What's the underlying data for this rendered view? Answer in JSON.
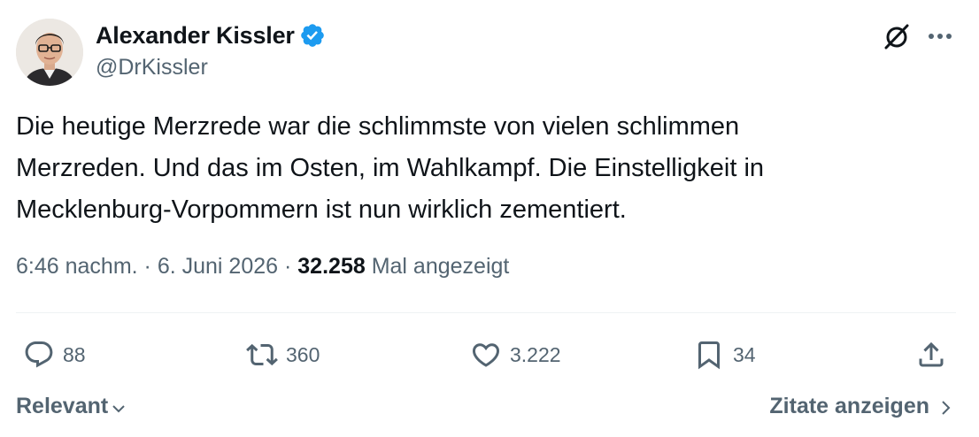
{
  "author": {
    "display_name": "Alexander Kissler",
    "handle": "@DrKissler",
    "verified": true
  },
  "tweet": {
    "text_lines": [
      "Die heutige Merzrede war die schlimmste von vielen schlimmen",
      "Merzreden. Und das im Osten, im Wahlkampf. Die Einstelligkeit in",
      "Mecklenburg-Vorpommern ist nun wirklich zementiert."
    ],
    "time": "6:46 nachm.",
    "date": "6. Juni 2026",
    "separator": "·",
    "views": "32.258",
    "views_label": "Mal angezeigt"
  },
  "actions": {
    "replies": "88",
    "reposts": "360",
    "likes": "3.222",
    "bookmarks": "34"
  },
  "footer": {
    "sort_label": "Relevant",
    "quotes_label": "Zitate anzeigen"
  },
  "colors": {
    "text_primary": "#0f1419",
    "text_secondary": "#536471",
    "verified_blue": "#1d9bf0",
    "divider": "#eff3f4"
  },
  "icons": {
    "verified": "verified-badge-icon",
    "grok": "grok-icon",
    "more": "more-icon",
    "reply": "reply-icon",
    "repost": "repost-icon",
    "like": "heart-icon",
    "bookmark": "bookmark-icon",
    "share": "share-icon",
    "sort": "chevron-down-icon",
    "quotes": "chevron-right-icon"
  }
}
